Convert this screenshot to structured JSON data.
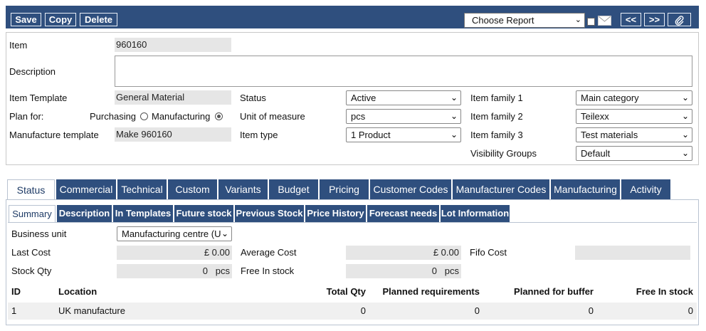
{
  "toolbar": {
    "save_label": "Save",
    "copy_label": "Copy",
    "delete_label": "Delete",
    "report_select": "Choose Report",
    "prev_label": "<<",
    "next_label": ">>",
    "icons": [
      "checkbox",
      "mail-icon",
      "paperclip-icon"
    ]
  },
  "header": {
    "item_label": "Item",
    "item_value": "960160",
    "description_label": "Description",
    "description_value": "",
    "item_template_label": "Item Template",
    "item_template_value": "General Material",
    "plan_for_label": "Plan for:",
    "purchasing_label": "Purchasing",
    "manufacturing_label": "Manufacturing",
    "plan_for_selected": "Manufacturing",
    "manufacture_template_label": "Manufacture template",
    "manufacture_template_value": "Make 960160",
    "status_label": "Status",
    "status_value": "Active",
    "uom_label": "Unit of measure",
    "uom_value": "pcs",
    "item_type_label": "Item type",
    "item_type_value": "1 Product",
    "family1_label": "Item family 1",
    "family1_value": "Main category",
    "family2_label": "Item family 2",
    "family2_value": "Teilexx",
    "family3_label": "Item family 3",
    "family3_value": "Test materials",
    "visibility_label": "Visibility Groups",
    "visibility_value": "Default"
  },
  "tabs": [
    "Status",
    "Commercial",
    "Technical",
    "Custom",
    "Variants",
    "Budget",
    "Pricing",
    "Customer Codes",
    "Manufacturer Codes",
    "Manufacturing",
    "Activity"
  ],
  "active_tab": "Status",
  "subtabs": [
    "Summary",
    "Description",
    "In Templates",
    "Future stock",
    "Previous Stock",
    "Price History",
    "Forecast needs",
    "Lot Information"
  ],
  "active_subtab": "Summary",
  "summary": {
    "business_unit_label": "Business unit",
    "business_unit_value": "Manufacturing centre (U",
    "last_cost_label": "Last Cost",
    "last_cost_value": "£ 0.00",
    "average_cost_label": "Average Cost",
    "average_cost_value": "£ 0.00",
    "fifo_cost_label": "Fifo Cost",
    "fifo_cost_value": "",
    "stock_qty_label": "Stock Qty",
    "stock_qty_value": "0",
    "stock_qty_unit": "pcs",
    "free_in_stock_label": "Free In stock",
    "free_in_stock_value": "0",
    "free_in_stock_unit": "pcs"
  },
  "table": {
    "headers": [
      "ID",
      "Location",
      "Total Qty",
      "Planned requirements",
      "Planned for buffer",
      "Free In stock"
    ],
    "rows": [
      [
        "1",
        "UK manufacture",
        "0",
        "0",
        "0",
        "0"
      ]
    ]
  },
  "colors": {
    "bar": "#2f4f7e",
    "readonly": "#e6e6e6",
    "row": "#f0f0f0"
  }
}
